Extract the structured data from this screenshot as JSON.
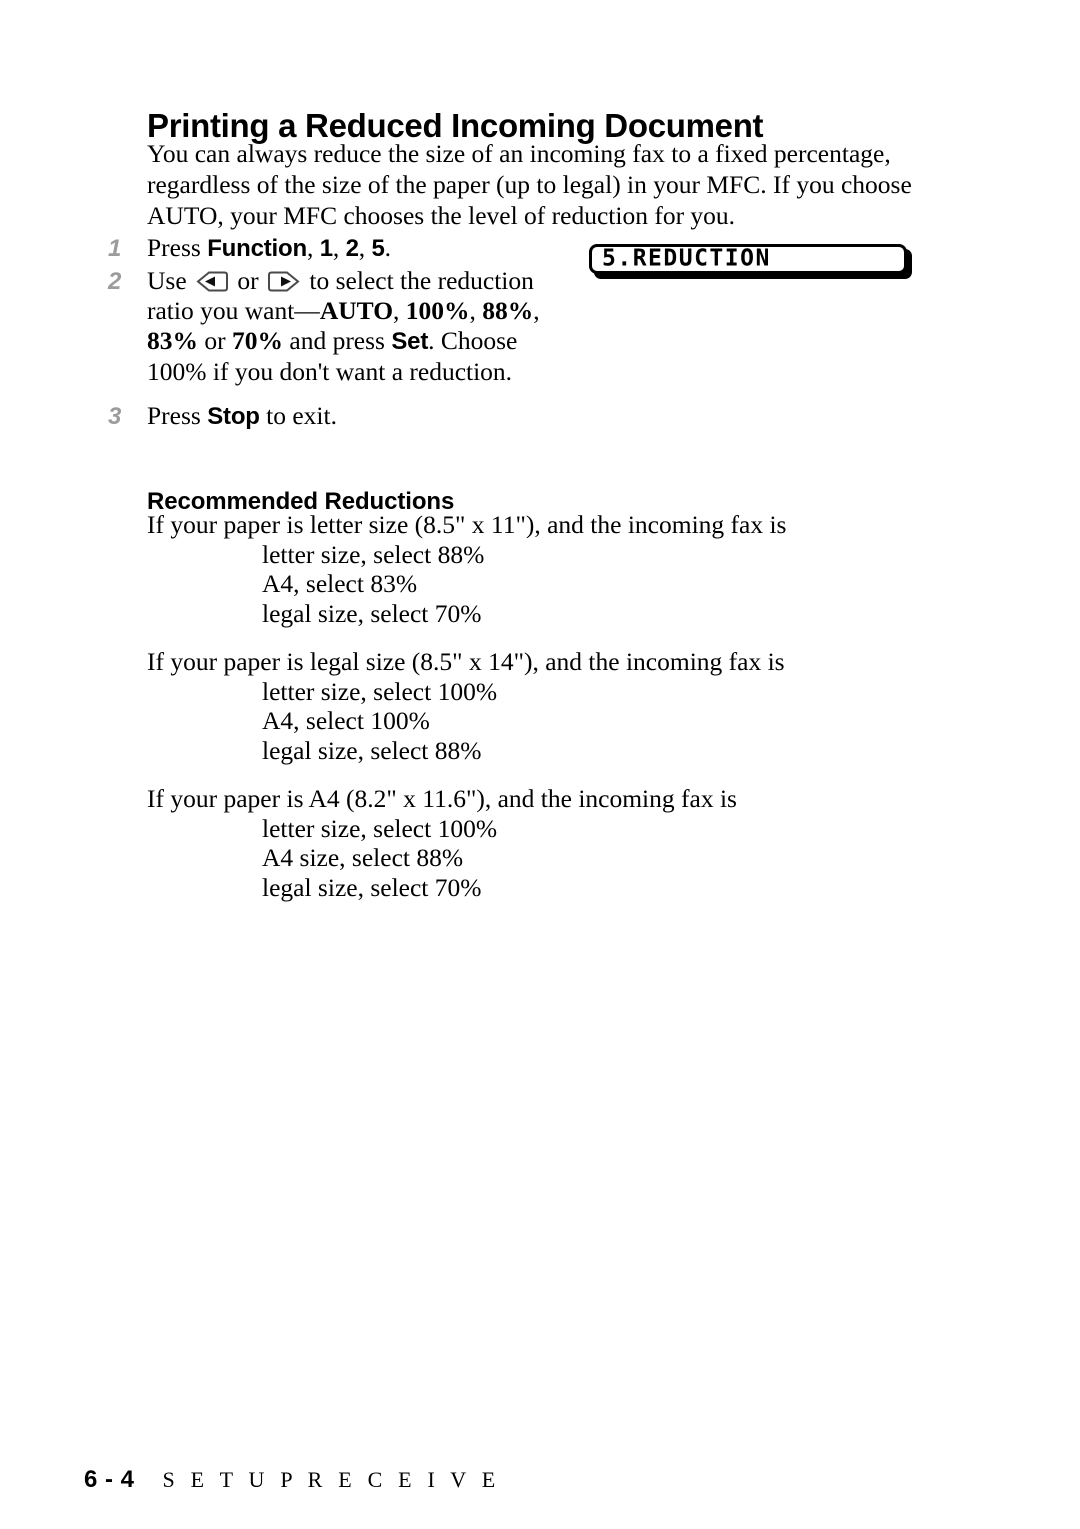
{
  "document": {
    "title": "Printing a Reduced Incoming Document",
    "subheading": "Recommended Reductions"
  },
  "intro": {
    "line1": "You can always reduce the size of an incoming fax to a fixed percentage,",
    "line2": "regardless of the size of the paper (up to legal) in your MFC.  If you choose",
    "line3": "AUTO, your MFC chooses the level of reduction for you."
  },
  "steps": {
    "step1": {
      "number": "1",
      "pre": "Press ",
      "key_function": "Function",
      "comma1": ", ",
      "key_1": "1",
      "comma2": ", ",
      "key_2": "2",
      "comma3": ", ",
      "key_5": "5",
      "post": "."
    },
    "step2": {
      "number": "2",
      "line1_pre": "Use ",
      "left_arrow_icon": "left-arrow-key-icon",
      "line1_mid": " or ",
      "right_arrow_icon": "right-arrow-key-icon",
      "line1_post": " to select the reduction",
      "line2_pre": "ratio you want—",
      "opt_auto": "AUTO",
      "line2_sep1": ", ",
      "opt_100": "100%",
      "line2_sep2": ", ",
      "opt_88": "88%",
      "line2_post": ",",
      "line3_pre": "",
      "opt_83": "83%",
      "line3_mid": " or ",
      "opt_70": "70%",
      "line3_mid2": " and press ",
      "key_set": "Set",
      "line3_post": ".  Choose",
      "line4": "100% if you don't want a reduction."
    },
    "step3": {
      "number": "3",
      "pre": "Press ",
      "key_stop": "Stop",
      "post": " to exit."
    }
  },
  "lcd": {
    "text": "5.REDUCTION"
  },
  "recommendations": [
    {
      "lead": "If your paper is letter size (8.5\" x 11\"), and the incoming fax is",
      "items": [
        "letter size, select 88%",
        "A4, select 83%",
        "legal size, select 70%"
      ]
    },
    {
      "lead": "If your paper is legal size (8.5\" x 14\"), and the incoming fax is",
      "items": [
        "letter size, select 100%",
        "A4, select 100%",
        "legal size, select 88%"
      ]
    },
    {
      "lead": "If your paper is A4 (8.2\" x 11.6\"), and the incoming fax is",
      "items": [
        "letter size, select 100%",
        "A4 size, select 88%",
        "legal size, select 70%"
      ]
    }
  ],
  "footer": {
    "page_number": "6 - 4",
    "section": "S E T U P   R E C E I V E"
  },
  "colors": {
    "text": "#000000",
    "step_number": "#9c9c9c",
    "page_background": "#ffffff"
  }
}
